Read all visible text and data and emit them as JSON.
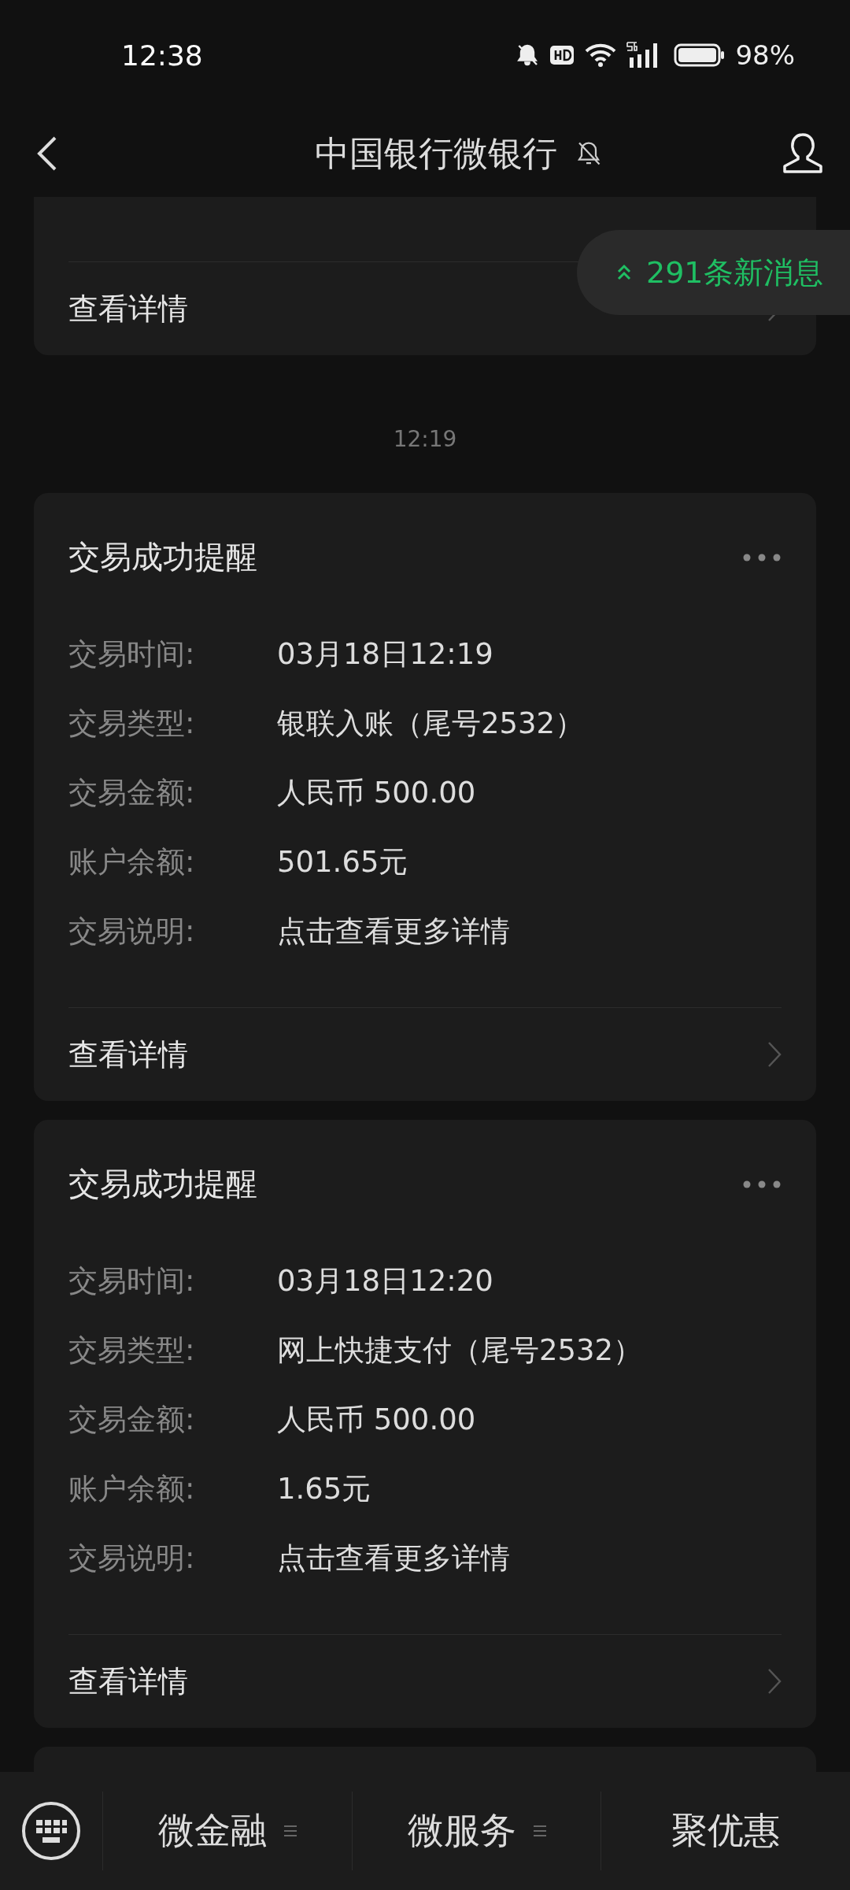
{
  "status_bar": {
    "time": "12:38",
    "battery": "98%"
  },
  "header": {
    "title": "中国银行微银行"
  },
  "new_messages": {
    "label": "291条新消息"
  },
  "previous_card": {
    "detail_link": "查看详情"
  },
  "timestamp": "12:19",
  "cards": [
    {
      "title": "交易成功提醒",
      "rows": [
        {
          "label": "交易时间:",
          "value": "03月18日12:19"
        },
        {
          "label": "交易类型:",
          "value": "银联入账（尾号2532）"
        },
        {
          "label": "交易金额:",
          "value": "人民币 500.00"
        },
        {
          "label": "账户余额:",
          "value": "501.65元"
        },
        {
          "label": "交易说明:",
          "value": "点击查看更多详情"
        }
      ],
      "detail_link": "查看详情"
    },
    {
      "title": "交易成功提醒",
      "rows": [
        {
          "label": "交易时间:",
          "value": "03月18日12:20"
        },
        {
          "label": "交易类型:",
          "value": "网上快捷支付（尾号2532）"
        },
        {
          "label": "交易金额:",
          "value": "人民币 500.00"
        },
        {
          "label": "账户余额:",
          "value": "1.65元"
        },
        {
          "label": "交易说明:",
          "value": "点击查看更多详情"
        }
      ],
      "detail_link": "查看详情"
    }
  ],
  "bottom_menu": [
    {
      "label": "微金融",
      "has_submenu": true
    },
    {
      "label": "微服务",
      "has_submenu": true
    },
    {
      "label": "聚优惠",
      "has_submenu": false
    }
  ]
}
